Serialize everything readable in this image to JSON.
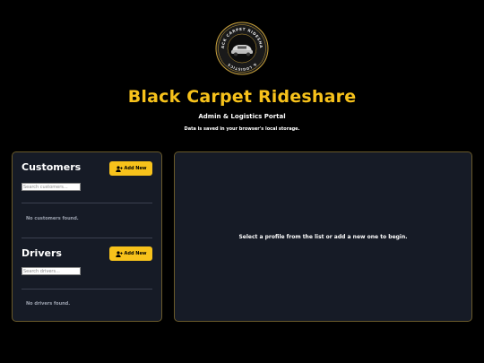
{
  "header": {
    "logo_text": "BLACK CARPET RIDESHARE & LOGISTICS",
    "title": "Black Carpet Rideshare",
    "subtitle": "Admin & Logistics Portal",
    "note": "Data is saved in your browser's local storage."
  },
  "customers": {
    "heading": "Customers",
    "add_label": "Add New",
    "add_icon": "user-plus-icon",
    "search_placeholder": "Search customers...",
    "empty_text": "No customers found."
  },
  "drivers": {
    "heading": "Drivers",
    "add_label": "Add New",
    "add_icon": "user-plus-icon",
    "search_placeholder": "Search drivers...",
    "empty_text": "No drivers found."
  },
  "detail": {
    "message": "Select a profile from the list or add a new one to begin."
  },
  "colors": {
    "accent": "#f7c21b",
    "background": "#000000",
    "panel": "#161b26",
    "panel_border": "#6a5a2a"
  }
}
